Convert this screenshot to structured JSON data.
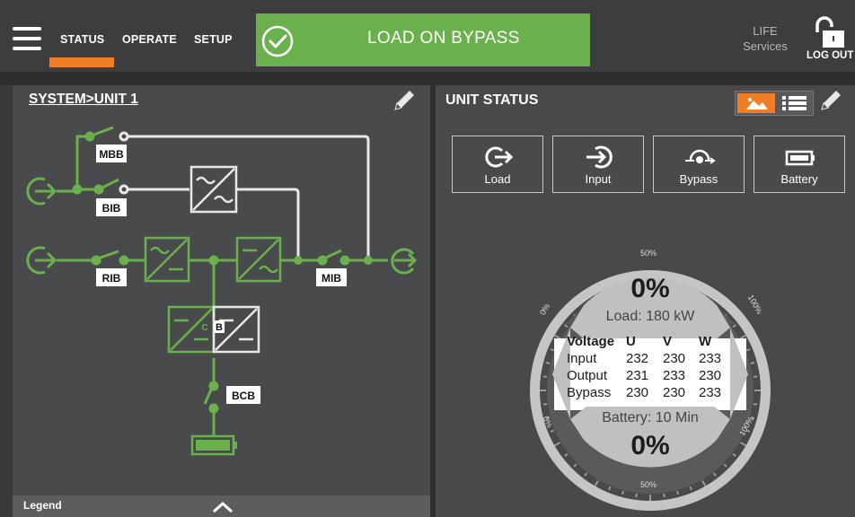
{
  "nav": {
    "tabs": [
      "STATUS",
      "OPERATE",
      "SETUP"
    ],
    "active_tab": "STATUS"
  },
  "banner": {
    "text": "LOAD ON BYPASS",
    "color": "#6ab04c"
  },
  "life_services": {
    "line1": "LIFE",
    "line2": "Services"
  },
  "logout_label": "LOG OUT",
  "left_panel": {
    "title": "SYSTEM>UNIT 1",
    "labels": {
      "mbb": "MBB",
      "bib": "BIB",
      "rib": "RIB",
      "mib": "MIB",
      "bcb": "BCB",
      "c": "C",
      "b": "B"
    },
    "legend_label": "Legend"
  },
  "right_panel": {
    "title": "UNIT STATUS",
    "buttons": [
      "Load",
      "Input",
      "Bypass",
      "Battery"
    ],
    "gauge": {
      "load_percent": "0%",
      "load_label": "Load: 180 kW",
      "table_headers": [
        "Voltage",
        "U",
        "V",
        "W"
      ],
      "rows": [
        {
          "name": "Input",
          "u": "232",
          "v": "230",
          "w": "233"
        },
        {
          "name": "Output",
          "u": "231",
          "v": "233",
          "w": "230"
        },
        {
          "name": "Bypass",
          "u": "230",
          "v": "230",
          "w": "233"
        }
      ],
      "battery_label": "Battery: 10 Min",
      "battery_percent": "0%",
      "scale_labels": {
        "top": "50%",
        "upper_left": "0%",
        "upper_right": "100%",
        "lower_left": "0%",
        "lower_right": "100%",
        "bottom": "50%"
      }
    }
  },
  "colors": {
    "accent": "#f07e26",
    "green": "#6ab04c"
  }
}
